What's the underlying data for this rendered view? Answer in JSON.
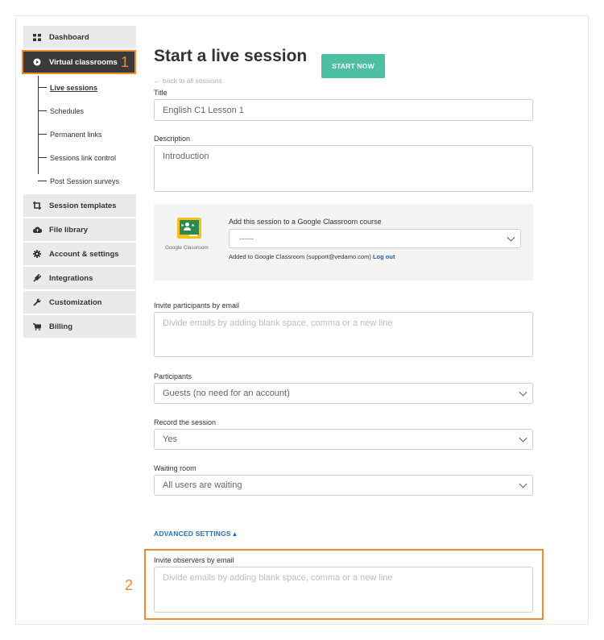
{
  "sidebar": {
    "items": [
      {
        "label": "Dashboard",
        "icon": "grid-icon"
      },
      {
        "label": "Virtual classrooms",
        "icon": "play-circle-icon",
        "active": true
      },
      {
        "label": "Session templates",
        "icon": "crop-icon"
      },
      {
        "label": "File library",
        "icon": "cloud-upload-icon"
      },
      {
        "label": "Account & settings",
        "icon": "gear-icon"
      },
      {
        "label": "Integrations",
        "icon": "plug-icon"
      },
      {
        "label": "Customization",
        "icon": "wrench-icon"
      },
      {
        "label": "Billing",
        "icon": "cart-icon"
      }
    ],
    "subitems": [
      {
        "label": "Live sessions",
        "current": true
      },
      {
        "label": "Schedules"
      },
      {
        "label": "Permanent links"
      },
      {
        "label": "Sessions link control"
      },
      {
        "label": "Post Session surveys"
      }
    ]
  },
  "annotations": {
    "marker1": "1",
    "marker2": "2",
    "accent": "#f08a2c"
  },
  "header": {
    "title": "Start a live session",
    "start_button": "START NOW",
    "back_link": "← back to all sessions"
  },
  "form": {
    "title_label": "Title",
    "title_value": "English C1 Lesson 1",
    "description_label": "Description",
    "description_value": "Introduction",
    "google_classroom": {
      "name": "Google Classroom",
      "title": "Add this session to a Google Classroom course",
      "selected": "------",
      "note": "Added to Google Classroom (support@vedamo.com)",
      "logout": "Log out"
    },
    "invite_label": "Invite participants by email",
    "invite_placeholder": "Divide emails by adding blank space, comma or a new line",
    "participants_label": "Participants",
    "participants_value": "Guests (no need for an account)",
    "record_label": "Record the session",
    "record_value": "Yes",
    "waiting_label": "Waiting room",
    "waiting_value": "All users are waiting",
    "advanced_label": "ADVANCED SETTINGS ▴",
    "observers_label": "Invite observers by email",
    "observers_placeholder": "Divide emails by adding blank space, comma or a new line"
  },
  "colors": {
    "start_button": "#4dbfa3",
    "link": "#2a6fb5",
    "active_nav": "#3a3a3a"
  }
}
